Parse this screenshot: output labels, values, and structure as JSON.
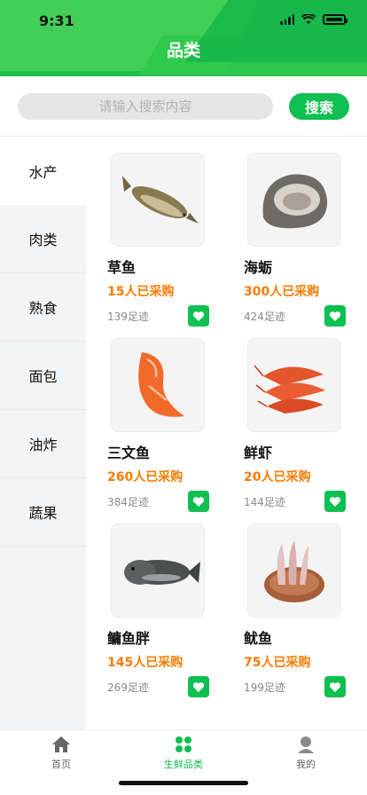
{
  "status_bar": {
    "time": "9:31"
  },
  "header": {
    "title": "品类"
  },
  "search": {
    "placeholder": "请输入搜索内容",
    "button_label": "搜索"
  },
  "sidebar": {
    "items": [
      {
        "label": "水产",
        "active": true
      },
      {
        "label": "肉类",
        "active": false
      },
      {
        "label": "熟食",
        "active": false
      },
      {
        "label": "面包",
        "active": false
      },
      {
        "label": "油炸",
        "active": false
      },
      {
        "label": "蔬果",
        "active": false
      }
    ]
  },
  "products": [
    {
      "name": "草鱼",
      "buyers": "15人已采购",
      "views": "139足迹",
      "icon": "fish-image"
    },
    {
      "name": "海蛎",
      "buyers": "300人已采购",
      "views": "424足迹",
      "icon": "oyster-image"
    },
    {
      "name": "三文鱼",
      "buyers": "260人已采购",
      "views": "384足迹",
      "icon": "salmon-image"
    },
    {
      "name": "鲜虾",
      "buyers": "20人已采购",
      "views": "144足迹",
      "icon": "shrimp-image"
    },
    {
      "name": "鳙鱼胖",
      "buyers": "145人已采购",
      "views": "269足迹",
      "icon": "bighead-carp-image"
    },
    {
      "name": "鱿鱼",
      "buyers": "75人已采购",
      "views": "199足迹",
      "icon": "squid-image"
    }
  ],
  "tabbar": {
    "items": [
      {
        "label": "首页",
        "icon": "home-icon",
        "active": false
      },
      {
        "label": "生鲜品类",
        "icon": "grid-icon",
        "active": true
      },
      {
        "label": "我的",
        "icon": "user-icon",
        "active": false
      }
    ]
  },
  "colors": {
    "brand": "#0fbf50",
    "accent": "#ff7a00"
  }
}
